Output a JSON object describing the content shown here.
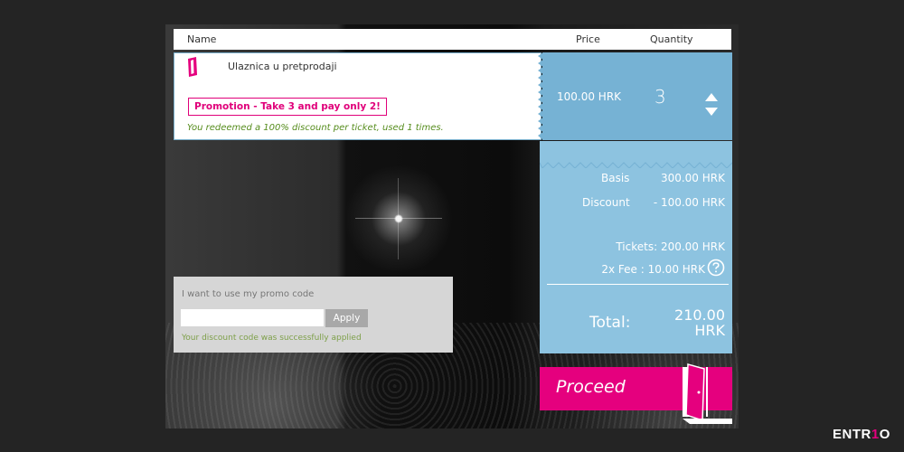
{
  "table_header": {
    "name": "Name",
    "price": "Price",
    "quantity": "Quantity"
  },
  "item": {
    "name": "Ulaznica u pretprodaji",
    "promotion": "Promotion - Take 3 and pay only 2!",
    "discount_note": "You redeemed a 100% discount per ticket, used 1 times.",
    "price": "100.00 HRK",
    "quantity": "3"
  },
  "summary": {
    "basis_label": "Basis",
    "basis_value": "300.00 HRK",
    "discount_label": "Discount",
    "discount_value": "- 100.00 HRK",
    "tickets": "Tickets: 200.00 HRK",
    "fee": "2x Fee : 10.00 HRK",
    "total_label": "Total:",
    "total_amount": "210.00",
    "total_currency": "HRK"
  },
  "promo": {
    "label": "I want to use my promo code",
    "input_value": "",
    "apply_label": "Apply",
    "success_message": "Your discount code was successfully applied"
  },
  "proceed_label": "Proceed",
  "brand": {
    "prefix": "ENTR",
    "mark": "1",
    "suffix": "O"
  },
  "colors": {
    "accent": "#e5007e",
    "panel_blue": "#76b2d4",
    "summary_blue": "#8dc3e0",
    "success_green": "#558c1c"
  },
  "icons": {
    "ticket": "ticket-icon",
    "quantity_up": "arrow-up-icon",
    "quantity_down": "arrow-down-icon",
    "help": "question-circle-icon",
    "door": "door-icon"
  }
}
